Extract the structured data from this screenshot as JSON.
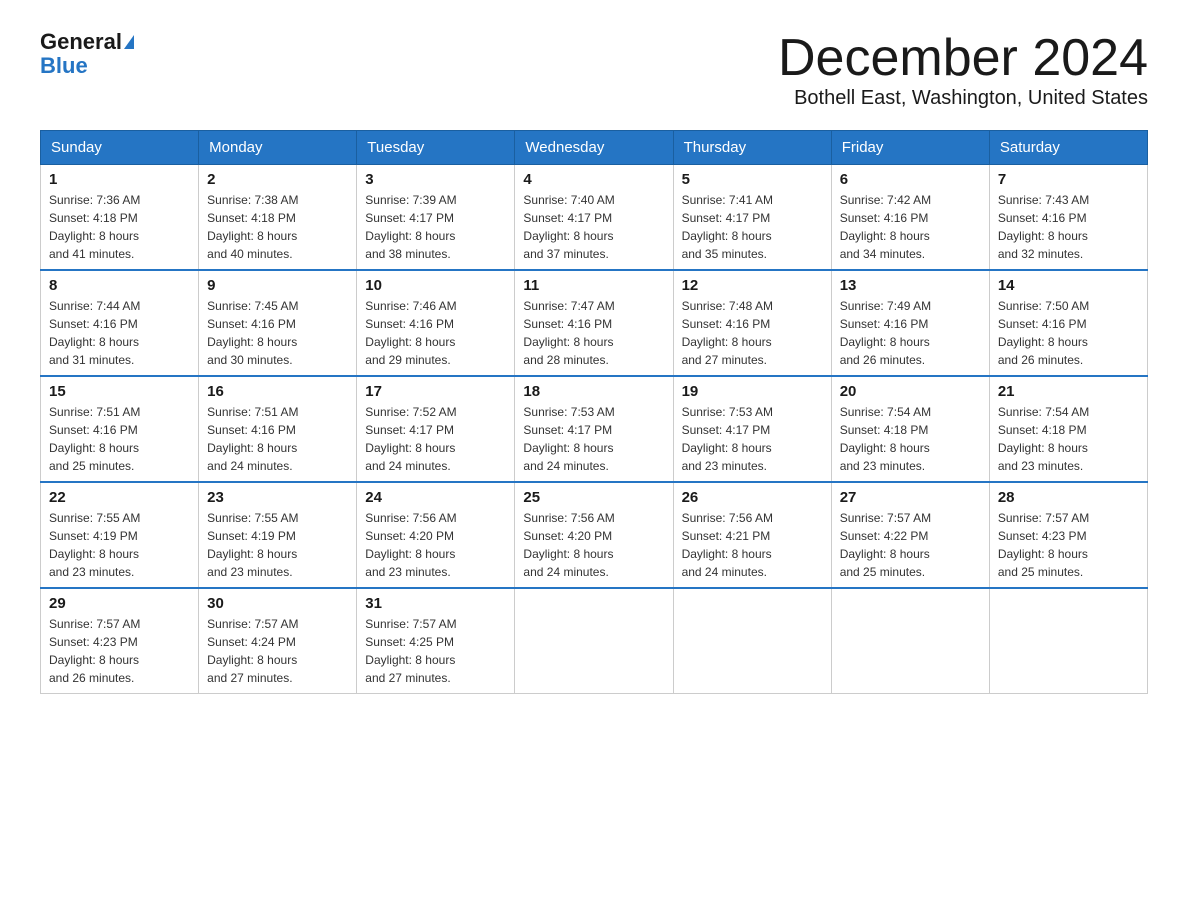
{
  "header": {
    "logo_general": "General",
    "logo_blue": "Blue",
    "month_title": "December 2024",
    "location": "Bothell East, Washington, United States"
  },
  "weekdays": [
    "Sunday",
    "Monday",
    "Tuesday",
    "Wednesday",
    "Thursday",
    "Friday",
    "Saturday"
  ],
  "weeks": [
    [
      {
        "day": "1",
        "sunrise": "7:36 AM",
        "sunset": "4:18 PM",
        "daylight": "8 hours and 41 minutes."
      },
      {
        "day": "2",
        "sunrise": "7:38 AM",
        "sunset": "4:18 PM",
        "daylight": "8 hours and 40 minutes."
      },
      {
        "day": "3",
        "sunrise": "7:39 AM",
        "sunset": "4:17 PM",
        "daylight": "8 hours and 38 minutes."
      },
      {
        "day": "4",
        "sunrise": "7:40 AM",
        "sunset": "4:17 PM",
        "daylight": "8 hours and 37 minutes."
      },
      {
        "day": "5",
        "sunrise": "7:41 AM",
        "sunset": "4:17 PM",
        "daylight": "8 hours and 35 minutes."
      },
      {
        "day": "6",
        "sunrise": "7:42 AM",
        "sunset": "4:16 PM",
        "daylight": "8 hours and 34 minutes."
      },
      {
        "day": "7",
        "sunrise": "7:43 AM",
        "sunset": "4:16 PM",
        "daylight": "8 hours and 32 minutes."
      }
    ],
    [
      {
        "day": "8",
        "sunrise": "7:44 AM",
        "sunset": "4:16 PM",
        "daylight": "8 hours and 31 minutes."
      },
      {
        "day": "9",
        "sunrise": "7:45 AM",
        "sunset": "4:16 PM",
        "daylight": "8 hours and 30 minutes."
      },
      {
        "day": "10",
        "sunrise": "7:46 AM",
        "sunset": "4:16 PM",
        "daylight": "8 hours and 29 minutes."
      },
      {
        "day": "11",
        "sunrise": "7:47 AM",
        "sunset": "4:16 PM",
        "daylight": "8 hours and 28 minutes."
      },
      {
        "day": "12",
        "sunrise": "7:48 AM",
        "sunset": "4:16 PM",
        "daylight": "8 hours and 27 minutes."
      },
      {
        "day": "13",
        "sunrise": "7:49 AM",
        "sunset": "4:16 PM",
        "daylight": "8 hours and 26 minutes."
      },
      {
        "day": "14",
        "sunrise": "7:50 AM",
        "sunset": "4:16 PM",
        "daylight": "8 hours and 26 minutes."
      }
    ],
    [
      {
        "day": "15",
        "sunrise": "7:51 AM",
        "sunset": "4:16 PM",
        "daylight": "8 hours and 25 minutes."
      },
      {
        "day": "16",
        "sunrise": "7:51 AM",
        "sunset": "4:16 PM",
        "daylight": "8 hours and 24 minutes."
      },
      {
        "day": "17",
        "sunrise": "7:52 AM",
        "sunset": "4:17 PM",
        "daylight": "8 hours and 24 minutes."
      },
      {
        "day": "18",
        "sunrise": "7:53 AM",
        "sunset": "4:17 PM",
        "daylight": "8 hours and 24 minutes."
      },
      {
        "day": "19",
        "sunrise": "7:53 AM",
        "sunset": "4:17 PM",
        "daylight": "8 hours and 23 minutes."
      },
      {
        "day": "20",
        "sunrise": "7:54 AM",
        "sunset": "4:18 PM",
        "daylight": "8 hours and 23 minutes."
      },
      {
        "day": "21",
        "sunrise": "7:54 AM",
        "sunset": "4:18 PM",
        "daylight": "8 hours and 23 minutes."
      }
    ],
    [
      {
        "day": "22",
        "sunrise": "7:55 AM",
        "sunset": "4:19 PM",
        "daylight": "8 hours and 23 minutes."
      },
      {
        "day": "23",
        "sunrise": "7:55 AM",
        "sunset": "4:19 PM",
        "daylight": "8 hours and 23 minutes."
      },
      {
        "day": "24",
        "sunrise": "7:56 AM",
        "sunset": "4:20 PM",
        "daylight": "8 hours and 23 minutes."
      },
      {
        "day": "25",
        "sunrise": "7:56 AM",
        "sunset": "4:20 PM",
        "daylight": "8 hours and 24 minutes."
      },
      {
        "day": "26",
        "sunrise": "7:56 AM",
        "sunset": "4:21 PM",
        "daylight": "8 hours and 24 minutes."
      },
      {
        "day": "27",
        "sunrise": "7:57 AM",
        "sunset": "4:22 PM",
        "daylight": "8 hours and 25 minutes."
      },
      {
        "day": "28",
        "sunrise": "7:57 AM",
        "sunset": "4:23 PM",
        "daylight": "8 hours and 25 minutes."
      }
    ],
    [
      {
        "day": "29",
        "sunrise": "7:57 AM",
        "sunset": "4:23 PM",
        "daylight": "8 hours and 26 minutes."
      },
      {
        "day": "30",
        "sunrise": "7:57 AM",
        "sunset": "4:24 PM",
        "daylight": "8 hours and 27 minutes."
      },
      {
        "day": "31",
        "sunrise": "7:57 AM",
        "sunset": "4:25 PM",
        "daylight": "8 hours and 27 minutes."
      },
      null,
      null,
      null,
      null
    ]
  ],
  "labels": {
    "sunrise": "Sunrise:",
    "sunset": "Sunset:",
    "daylight": "Daylight:"
  }
}
